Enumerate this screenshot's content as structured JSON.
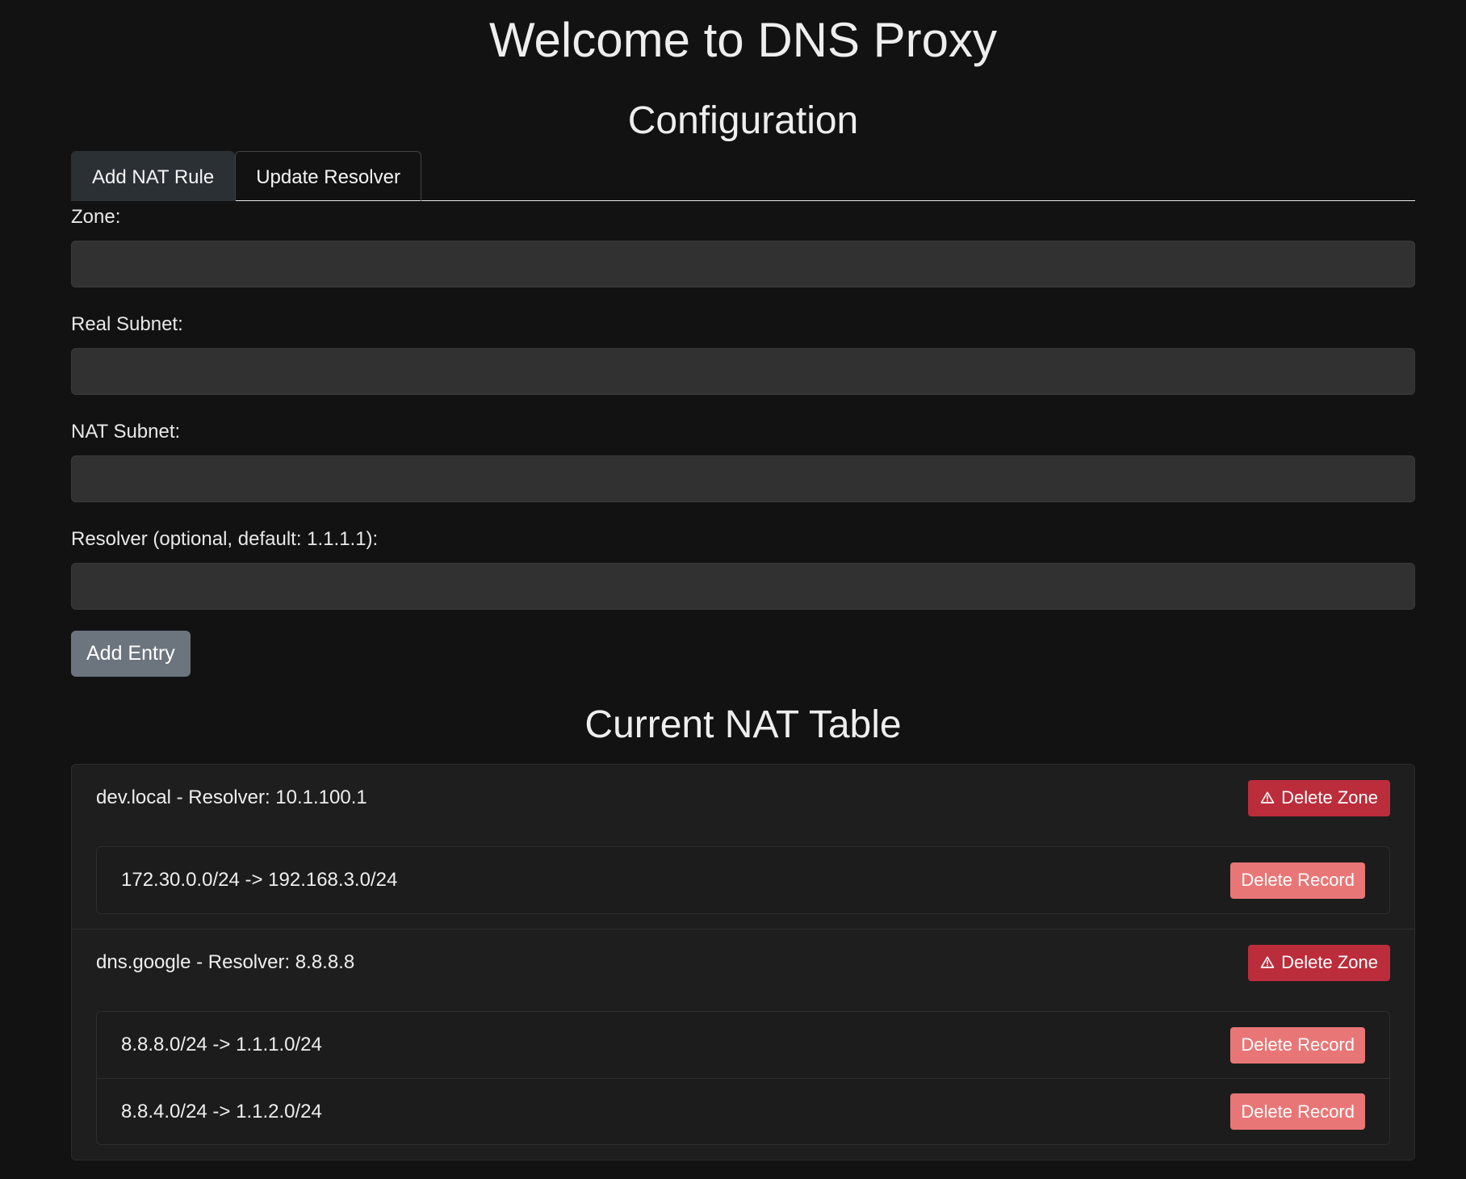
{
  "header": {
    "title": "Welcome to DNS Proxy"
  },
  "configuration": {
    "title": "Configuration",
    "tabs": [
      {
        "label": "Add NAT Rule",
        "active": true
      },
      {
        "label": "Update Resolver",
        "active": false
      }
    ],
    "fields": {
      "zone": {
        "label": "Zone:",
        "value": ""
      },
      "real_subnet": {
        "label": "Real Subnet:",
        "value": ""
      },
      "nat_subnet": {
        "label": "NAT Subnet:",
        "value": ""
      },
      "resolver": {
        "label": "Resolver (optional, default: 1.1.1.1):",
        "value": ""
      }
    },
    "add_button_label": "Add Entry"
  },
  "nat_table": {
    "title": "Current NAT Table",
    "delete_zone_label": "Delete Zone",
    "delete_record_label": "Delete Record",
    "warning_icon": "warning-icon",
    "colors": {
      "delete_zone": "#bb2d3b",
      "delete_record": "#e97676"
    },
    "zones": [
      {
        "title": "dev.local - Resolver: 10.1.100.1",
        "records": [
          {
            "text": "172.30.0.0/24 -> 192.168.3.0/24"
          }
        ]
      },
      {
        "title": "dns.google - Resolver: 8.8.8.8",
        "records": [
          {
            "text": "8.8.8.0/24 -> 1.1.1.0/24"
          },
          {
            "text": "8.8.4.0/24 -> 1.1.2.0/24"
          }
        ]
      }
    ]
  }
}
